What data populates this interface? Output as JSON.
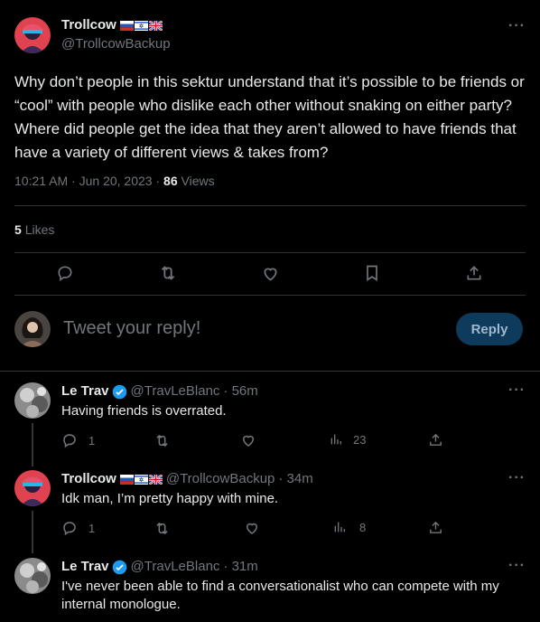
{
  "main_tweet": {
    "author_name": "Trollcow",
    "author_handle": "@TrollcowBackup",
    "text": "Why don’t people in this sektur understand that it’s possible to be friends or “cool” with people who dislike each other without snaking on either party? Where did people get the idea that they aren’t allowed to have friends that have a variety of different views & takes from?",
    "time": "10:21 AM",
    "date": "Jun 20, 2023",
    "views_count": "86",
    "views_label": "Views",
    "likes_count": "5",
    "likes_label": "Likes",
    "more": "···"
  },
  "reply_box": {
    "placeholder": "Tweet your reply!",
    "button_label": "Reply"
  },
  "replies": [
    {
      "name": "Le Trav",
      "handle": "@TravLeBlanc",
      "time": "· 56m",
      "text": "Having friends is overrated.",
      "reply_count": "1",
      "views": "23"
    },
    {
      "name": "Trollcow",
      "handle": "@TrollcowBackup",
      "time": "· 34m",
      "text": "Idk man, I’m pretty happy with mine.",
      "reply_count": "1",
      "views": "8"
    },
    {
      "name": "Le Trav",
      "handle": "@TravLeBlanc",
      "time": "· 31m",
      "text": "I've never been able to find a conversationalist who can compete with my internal monologue."
    }
  ],
  "colors": {
    "background": "#000000",
    "text": "#e7e9ea",
    "muted": "#71767b",
    "divider": "#2f3336",
    "verified": "#1d9bf0",
    "reply_button": "#0e3a5c"
  },
  "icons": [
    "reply-icon",
    "retweet-icon",
    "like-icon",
    "bookmark-icon",
    "share-icon",
    "views-icon",
    "verified-icon",
    "more-icon"
  ]
}
